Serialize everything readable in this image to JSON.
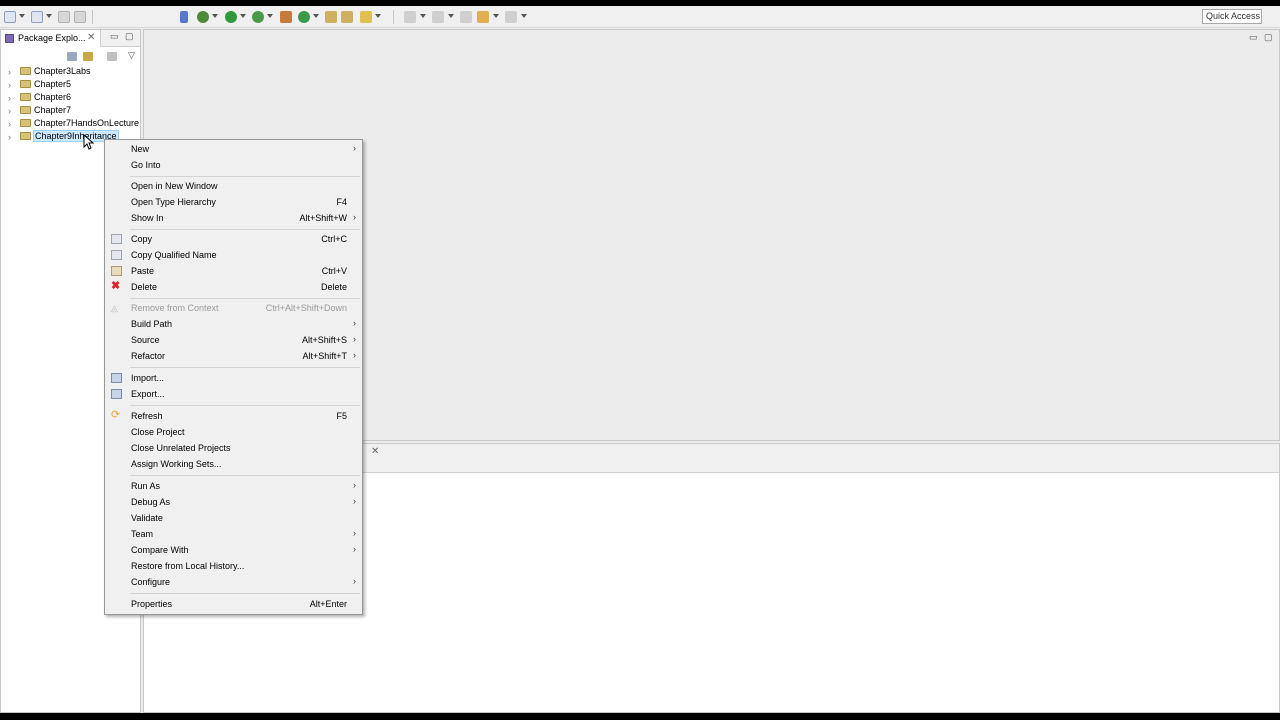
{
  "toolbar": {
    "quick_access": "Quick Access"
  },
  "package_explorer": {
    "tab_label": "Package Explo...",
    "items": [
      {
        "label": "Chapter3Labs",
        "selected": false
      },
      {
        "label": "Chapter5",
        "selected": false
      },
      {
        "label": "Chapter6",
        "selected": false
      },
      {
        "label": "Chapter7",
        "selected": false
      },
      {
        "label": "Chapter7HandsOnLecture",
        "selected": false
      },
      {
        "label": "Chapter9Inheritance",
        "selected": true
      }
    ]
  },
  "bottom_panel": {
    "tab_partial": "e"
  },
  "context_menu": {
    "items": [
      {
        "label": "New",
        "shortcut": "",
        "submenu": true
      },
      {
        "label": "Go Into",
        "shortcut": "",
        "submenu": false
      },
      {
        "label": "Open in New Window",
        "shortcut": "",
        "submenu": false
      },
      {
        "label": "Open Type Hierarchy",
        "shortcut": "F4",
        "submenu": false
      },
      {
        "label": "Show In",
        "shortcut": "Alt+Shift+W",
        "submenu": true
      },
      {
        "label": "Copy",
        "shortcut": "Ctrl+C",
        "submenu": false,
        "icon": "copy-icon"
      },
      {
        "label": "Copy Qualified Name",
        "shortcut": "",
        "submenu": false,
        "icon": "copy-qualified-icon"
      },
      {
        "label": "Paste",
        "shortcut": "Ctrl+V",
        "submenu": false,
        "icon": "paste-icon"
      },
      {
        "label": "Delete",
        "shortcut": "Delete",
        "submenu": false,
        "icon": "delete-icon"
      },
      {
        "label": "Remove from Context",
        "shortcut": "Ctrl+Alt+Shift+Down",
        "submenu": false,
        "disabled": true,
        "icon": "remove-context-icon"
      },
      {
        "label": "Build Path",
        "shortcut": "",
        "submenu": true
      },
      {
        "label": "Source",
        "shortcut": "Alt+Shift+S",
        "submenu": true
      },
      {
        "label": "Refactor",
        "shortcut": "Alt+Shift+T",
        "submenu": true
      },
      {
        "label": "Import...",
        "shortcut": "",
        "submenu": false,
        "icon": "import-icon"
      },
      {
        "label": "Export...",
        "shortcut": "",
        "submenu": false,
        "icon": "export-icon"
      },
      {
        "label": "Refresh",
        "shortcut": "F5",
        "submenu": false,
        "icon": "refresh-icon"
      },
      {
        "label": "Close Project",
        "shortcut": "",
        "submenu": false
      },
      {
        "label": "Close Unrelated Projects",
        "shortcut": "",
        "submenu": false
      },
      {
        "label": "Assign Working Sets...",
        "shortcut": "",
        "submenu": false
      },
      {
        "label": "Run As",
        "shortcut": "",
        "submenu": true
      },
      {
        "label": "Debug As",
        "shortcut": "",
        "submenu": true
      },
      {
        "label": "Validate",
        "shortcut": "",
        "submenu": false
      },
      {
        "label": "Team",
        "shortcut": "",
        "submenu": true
      },
      {
        "label": "Compare With",
        "shortcut": "",
        "submenu": true
      },
      {
        "label": "Restore from Local History...",
        "shortcut": "",
        "submenu": false
      },
      {
        "label": "Configure",
        "shortcut": "",
        "submenu": true
      },
      {
        "label": "Properties",
        "shortcut": "Alt+Enter",
        "submenu": false
      }
    ]
  },
  "colors": {
    "selection_bg": "#cde8ff",
    "delete_red": "#d9232e",
    "refresh_orange": "#e8a33a"
  }
}
